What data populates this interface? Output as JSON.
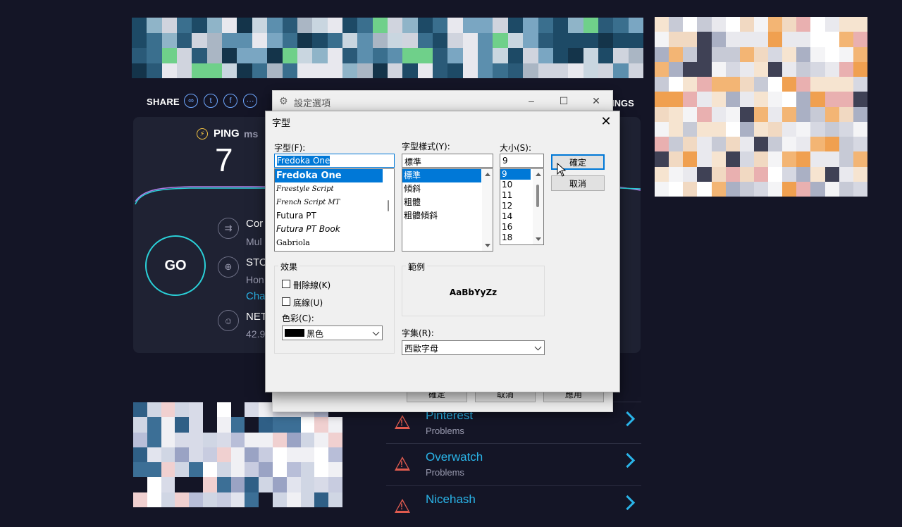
{
  "speedtest": {
    "share_label": "SHARE",
    "share_icons": [
      "link-icon",
      "twitter-icon",
      "facebook-icon",
      "more-icon"
    ],
    "settings_tail": "INGS",
    "ping_label": "PING",
    "ping_unit": "ms",
    "ping_value": "7",
    "go_label": "GO",
    "connections_title": "Cor",
    "connections_sub": "Mul",
    "server_title": "STO",
    "server_sub": "Hon",
    "server_link": "Cha",
    "network_title": "NET",
    "network_sub": "42.9",
    "accent_color": "#2ad0d8",
    "link_color": "#2ab4e8"
  },
  "problems": [
    {
      "title": "Pinterest",
      "status": "Problems"
    },
    {
      "title": "Overwatch",
      "status": "Problems"
    },
    {
      "title": "Nicehash",
      "status": ""
    }
  ],
  "back_dialog": {
    "title": "設定選項",
    "bottom_buttons": [
      "確定",
      "取消",
      "應用"
    ]
  },
  "font_dialog": {
    "title": "字型",
    "font_label": "字型(F):",
    "font_value": "Fredoka One",
    "font_list": [
      "Fredoka One",
      "Freestyle Script",
      "French Script MT",
      "Futura PT",
      "Futura PT Book",
      "Gabriola"
    ],
    "style_label": "字型樣式(Y):",
    "style_value": "標準",
    "style_list": [
      "標準",
      "傾斜",
      "粗體",
      "粗體傾斜"
    ],
    "size_label": "大小(S):",
    "size_value": "9",
    "size_list": [
      "9",
      "10",
      "11",
      "12",
      "14",
      "16",
      "18"
    ],
    "ok_label": "確定",
    "cancel_label": "取消",
    "effects_label": "效果",
    "strike_label": "刪除線(K)",
    "underline_label": "底線(U)",
    "color_label": "色彩(C):",
    "color_value": "黑色",
    "sample_label": "範例",
    "sample_text": "AaBbYyZz",
    "script_label": "字集(R):",
    "script_value": "西歐字母"
  }
}
